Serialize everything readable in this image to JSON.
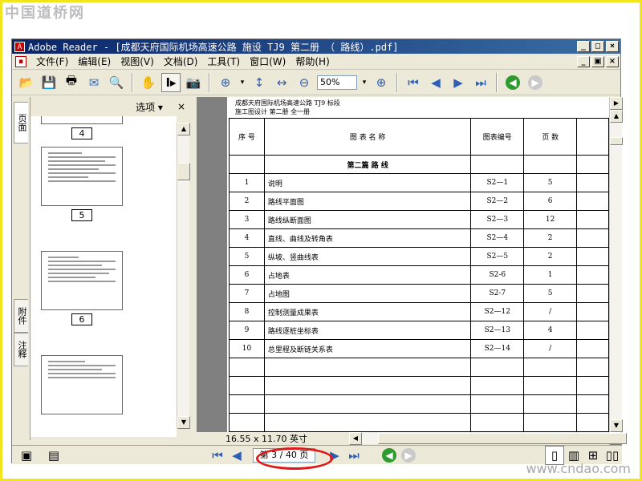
{
  "watermarks": {
    "top": "中国道桥网",
    "bottom": "www.cndao.com"
  },
  "window": {
    "title": "Adobe Reader - [成都天府国际机场高速公路 施设 TJ9 第二册 （ 路线）.pdf]",
    "buttons": [
      "_",
      "□",
      "×"
    ]
  },
  "menu": {
    "items": [
      "文件(F)",
      "编辑(E)",
      "视图(V)",
      "文档(D)",
      "工具(T)",
      "窗口(W)",
      "帮助(H)"
    ]
  },
  "toolbar": {
    "zoom_value": "50%",
    "icons": [
      "open-icon",
      "save-icon",
      "print-icon",
      "email-icon",
      "search-icon",
      "hand-icon",
      "select-text-icon",
      "snapshot-icon",
      "zoom-in-icon",
      "actual-size-icon",
      "fit-width-icon",
      "zoom-out-icon",
      "zoom-plus-icon",
      "first-page-icon",
      "prev-page-icon",
      "next-page-icon",
      "last-page-icon",
      "back-icon",
      "forward-icon"
    ]
  },
  "nav_tabs": {
    "pages": "页面",
    "attachments": "附件",
    "comments": "注释"
  },
  "thumbnails": {
    "options_label": "选项",
    "close": "×",
    "pages": [
      "4",
      "5",
      "6"
    ]
  },
  "document": {
    "header_line1": "成都天府国际机场高速公路 TJ9 标段",
    "header_line2": "施工图设计   第二册  全一册",
    "columns": [
      "序  号",
      "图  表  名  称",
      "图表编号",
      "页  数"
    ],
    "section_title": "第二篇  路  线",
    "rows": [
      {
        "no": "1",
        "name": "说明",
        "code": "S2—1",
        "pages": "5"
      },
      {
        "no": "2",
        "name": "路线平面图",
        "code": "S2—2",
        "pages": "6"
      },
      {
        "no": "3",
        "name": "路线纵断面图",
        "code": "S2—3",
        "pages": "12"
      },
      {
        "no": "4",
        "name": "直线、曲线及转角表",
        "code": "S2—4",
        "pages": "2"
      },
      {
        "no": "5",
        "name": "纵坡、竖曲线表",
        "code": "S2—5",
        "pages": "2"
      },
      {
        "no": "6",
        "name": "占地表",
        "code": "S2-6",
        "pages": "1"
      },
      {
        "no": "7",
        "name": "占地图",
        "code": "S2-7",
        "pages": "5"
      },
      {
        "no": "8",
        "name": "控制测量成果表",
        "code": "S2—12",
        "pages": "/"
      },
      {
        "no": "9",
        "name": "路线逐桩坐标表",
        "code": "S2—13",
        "pages": "4"
      },
      {
        "no": "10",
        "name": "总里程及断链关系表",
        "code": "S2—14",
        "pages": "/"
      }
    ]
  },
  "status": {
    "page_size": "16.55 x 11.70 英寸",
    "page_indicator": "第 3 / 40 页"
  }
}
